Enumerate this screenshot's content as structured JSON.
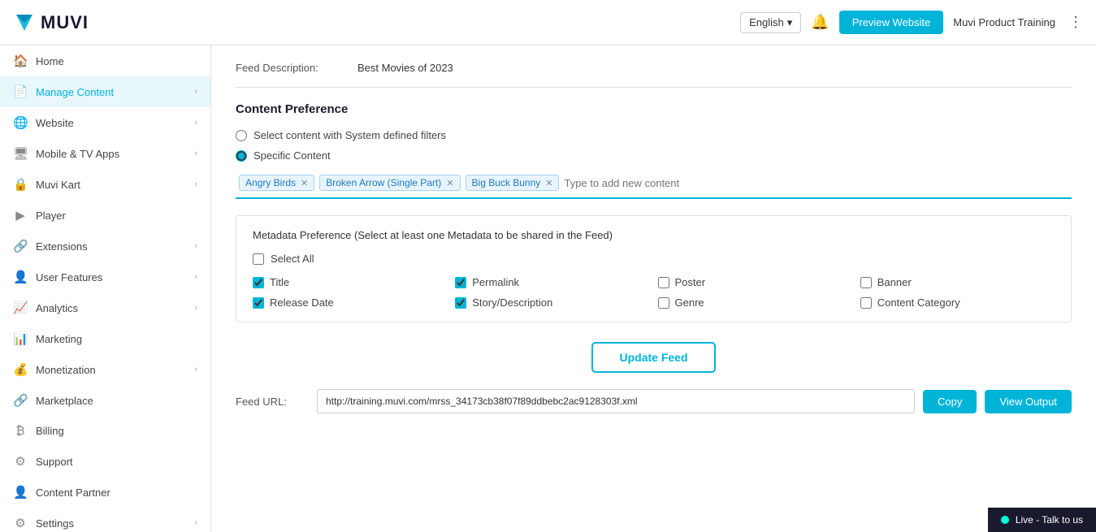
{
  "header": {
    "logo_text": "MUVI",
    "language": "English",
    "preview_button": "Preview Website",
    "user_name": "Muvi Product Training",
    "bell_icon": "bell",
    "dots_icon": "dots"
  },
  "sidebar": {
    "items": [
      {
        "id": "home",
        "label": "Home",
        "icon": "🏠",
        "active": false,
        "has_chevron": false
      },
      {
        "id": "manage-content",
        "label": "Manage Content",
        "icon": "📄",
        "active": true,
        "has_chevron": true
      },
      {
        "id": "website",
        "label": "Website",
        "icon": "🌐",
        "active": false,
        "has_chevron": true
      },
      {
        "id": "mobile-tv",
        "label": "Mobile & TV Apps",
        "icon": "🖥",
        "active": false,
        "has_chevron": true
      },
      {
        "id": "muvi-kart",
        "label": "Muvi Kart",
        "icon": "🔒",
        "active": false,
        "has_chevron": true
      },
      {
        "id": "player",
        "label": "Player",
        "icon": "▶",
        "active": false,
        "has_chevron": false
      },
      {
        "id": "extensions",
        "label": "Extensions",
        "icon": "🔗",
        "active": false,
        "has_chevron": true
      },
      {
        "id": "user-features",
        "label": "User Features",
        "icon": "👤",
        "active": false,
        "has_chevron": true
      },
      {
        "id": "analytics",
        "label": "Analytics",
        "icon": "📈",
        "active": false,
        "has_chevron": true
      },
      {
        "id": "marketing",
        "label": "Marketing",
        "icon": "📊",
        "active": false,
        "has_chevron": false
      },
      {
        "id": "monetization",
        "label": "Monetization",
        "icon": "💰",
        "active": false,
        "has_chevron": true
      },
      {
        "id": "marketplace",
        "label": "Marketplace",
        "icon": "🔗",
        "active": false,
        "has_chevron": false
      },
      {
        "id": "billing",
        "label": "Billing",
        "icon": "₿",
        "active": false,
        "has_chevron": false
      },
      {
        "id": "support",
        "label": "Support",
        "icon": "⚙",
        "active": false,
        "has_chevron": false
      },
      {
        "id": "content-partner",
        "label": "Content Partner",
        "icon": "👤",
        "active": false,
        "has_chevron": false
      },
      {
        "id": "settings",
        "label": "Settings",
        "icon": "⚙",
        "active": false,
        "has_chevron": true
      }
    ]
  },
  "main": {
    "feed_description_label": "Feed Description:",
    "feed_description_value": "Best Movies of 2023",
    "content_preference_title": "Content Preference",
    "option_system": "Select content with System defined filters",
    "option_specific": "Specific Content",
    "tags": [
      {
        "label": "Angry Birds",
        "id": "tag-angry-birds"
      },
      {
        "label": "Broken Arrow (Single Part)",
        "id": "tag-broken-arrow"
      },
      {
        "label": "Big Buck Bunny",
        "id": "tag-big-buck-bunny"
      }
    ],
    "tag_input_placeholder": "Type to add new content",
    "metadata_title": "Metadata Preference (Select at least one Metadata to be shared in the Feed)",
    "select_all_label": "Select All",
    "metadata_items": [
      {
        "label": "Title",
        "checked": true,
        "id": "meta-title"
      },
      {
        "label": "Permalink",
        "checked": true,
        "id": "meta-permalink"
      },
      {
        "label": "Poster",
        "checked": false,
        "id": "meta-poster"
      },
      {
        "label": "Banner",
        "checked": false,
        "id": "meta-banner"
      },
      {
        "label": "Release Date",
        "checked": true,
        "id": "meta-release-date"
      },
      {
        "label": "Story/Description",
        "checked": true,
        "id": "meta-story"
      },
      {
        "label": "Genre",
        "checked": false,
        "id": "meta-genre"
      },
      {
        "label": "Content Category",
        "checked": false,
        "id": "meta-content-category"
      }
    ],
    "update_feed_btn": "Update Feed",
    "feed_url_label": "Feed URL:",
    "feed_url_value": "http://training.muvi.com/mrss_34173cb38f07f89ddbebс2ac9128303f.xml",
    "copy_btn": "Copy",
    "view_output_btn": "View Output"
  },
  "live_chat": {
    "label": "Live - Talk to us"
  }
}
